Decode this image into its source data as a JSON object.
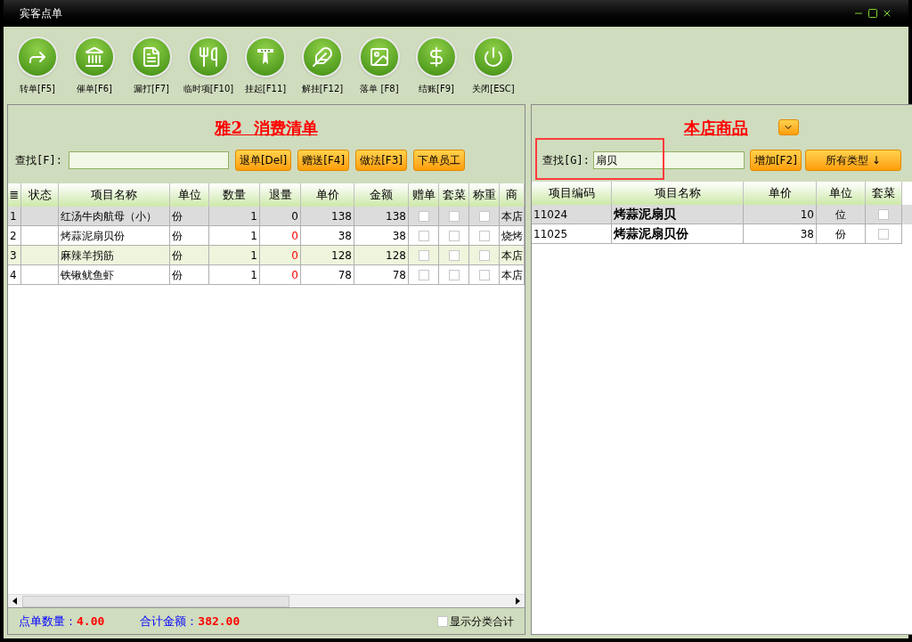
{
  "window": {
    "title": "宾客点单"
  },
  "toolbar": [
    {
      "label": "转单[F5]",
      "kind": "forward"
    },
    {
      "label": "催单[F6]",
      "kind": "bank"
    },
    {
      "label": "漏打[F7]",
      "kind": "document"
    },
    {
      "label": "临时项[F10]",
      "kind": "utensils"
    },
    {
      "label": "挂起[F11]",
      "kind": "hang"
    },
    {
      "label": "解挂[F12]",
      "kind": "unhang"
    },
    {
      "label": "落单 [F8]",
      "kind": "image"
    },
    {
      "label": "结账[F9]",
      "kind": "dollar"
    },
    {
      "label": "关闭[ESC]",
      "kind": "power"
    }
  ],
  "order": {
    "title": "雅2  消费清单",
    "search_label": "查找[F]:",
    "buttons": [
      "退单[Del]",
      "赠送[F4]",
      "做法[F3]",
      "下单员工"
    ],
    "columns": [
      "≣",
      "状态",
      "项目名称",
      "单位",
      "数量",
      "退量",
      "单价",
      "金额",
      "赠单",
      "套菜",
      "称重",
      "商"
    ],
    "rows": [
      {
        "index": "1",
        "name": "红汤牛肉航母（小）",
        "unit": "份",
        "qty": "1",
        "returned": "0",
        "returned_flagged": false,
        "price": "138",
        "amount": "138",
        "gift": false,
        "set": false,
        "weigh": false,
        "column_12": "本店",
        "selected": true
      },
      {
        "index": "2",
        "name": "烤蒜泥扇贝份",
        "unit": "份",
        "qty": "1",
        "returned": "0",
        "returned_flagged": true,
        "price": "38",
        "amount": "38",
        "gift": false,
        "set": false,
        "weigh": false,
        "column_12": "烧烤",
        "selected": false
      },
      {
        "index": "3",
        "name": "麻辣羊拐筋",
        "unit": "份",
        "qty": "1",
        "returned": "0",
        "returned_flagged": true,
        "price": "128",
        "amount": "128",
        "gift": false,
        "set": false,
        "weigh": false,
        "column_12": "本店",
        "selected": false
      },
      {
        "index": "4",
        "name": "铁锹鱿鱼虾",
        "unit": "份",
        "qty": "1",
        "returned": "0",
        "returned_flagged": true,
        "price": "78",
        "amount": "78",
        "gift": false,
        "set": false,
        "weigh": false,
        "column_12": "本店",
        "selected": false
      }
    ],
    "footer": {
      "count_label": "点单数量：",
      "count": "4.00",
      "total_label": "合计金额：",
      "total": "382.00",
      "show_category_label": "显示分类合计",
      "show_category": false
    }
  },
  "products": {
    "title": "本店商品",
    "search_label": "查找[G]:",
    "search_value": "扇贝",
    "search_highlighted": true,
    "add_button": "增加[F2]",
    "type_button": "所有类型 ↓",
    "columns": [
      "项目编码",
      "项目名称",
      "单价",
      "单位",
      "套菜"
    ],
    "rows": [
      {
        "code": "11024",
        "name": "烤蒜泥扇贝",
        "price": "10",
        "unit": "位",
        "set": false,
        "selected": true
      },
      {
        "code": "11025",
        "name": "烤蒜泥扇贝份",
        "price": "38",
        "unit": "份",
        "set": false,
        "selected": false
      }
    ]
  }
}
